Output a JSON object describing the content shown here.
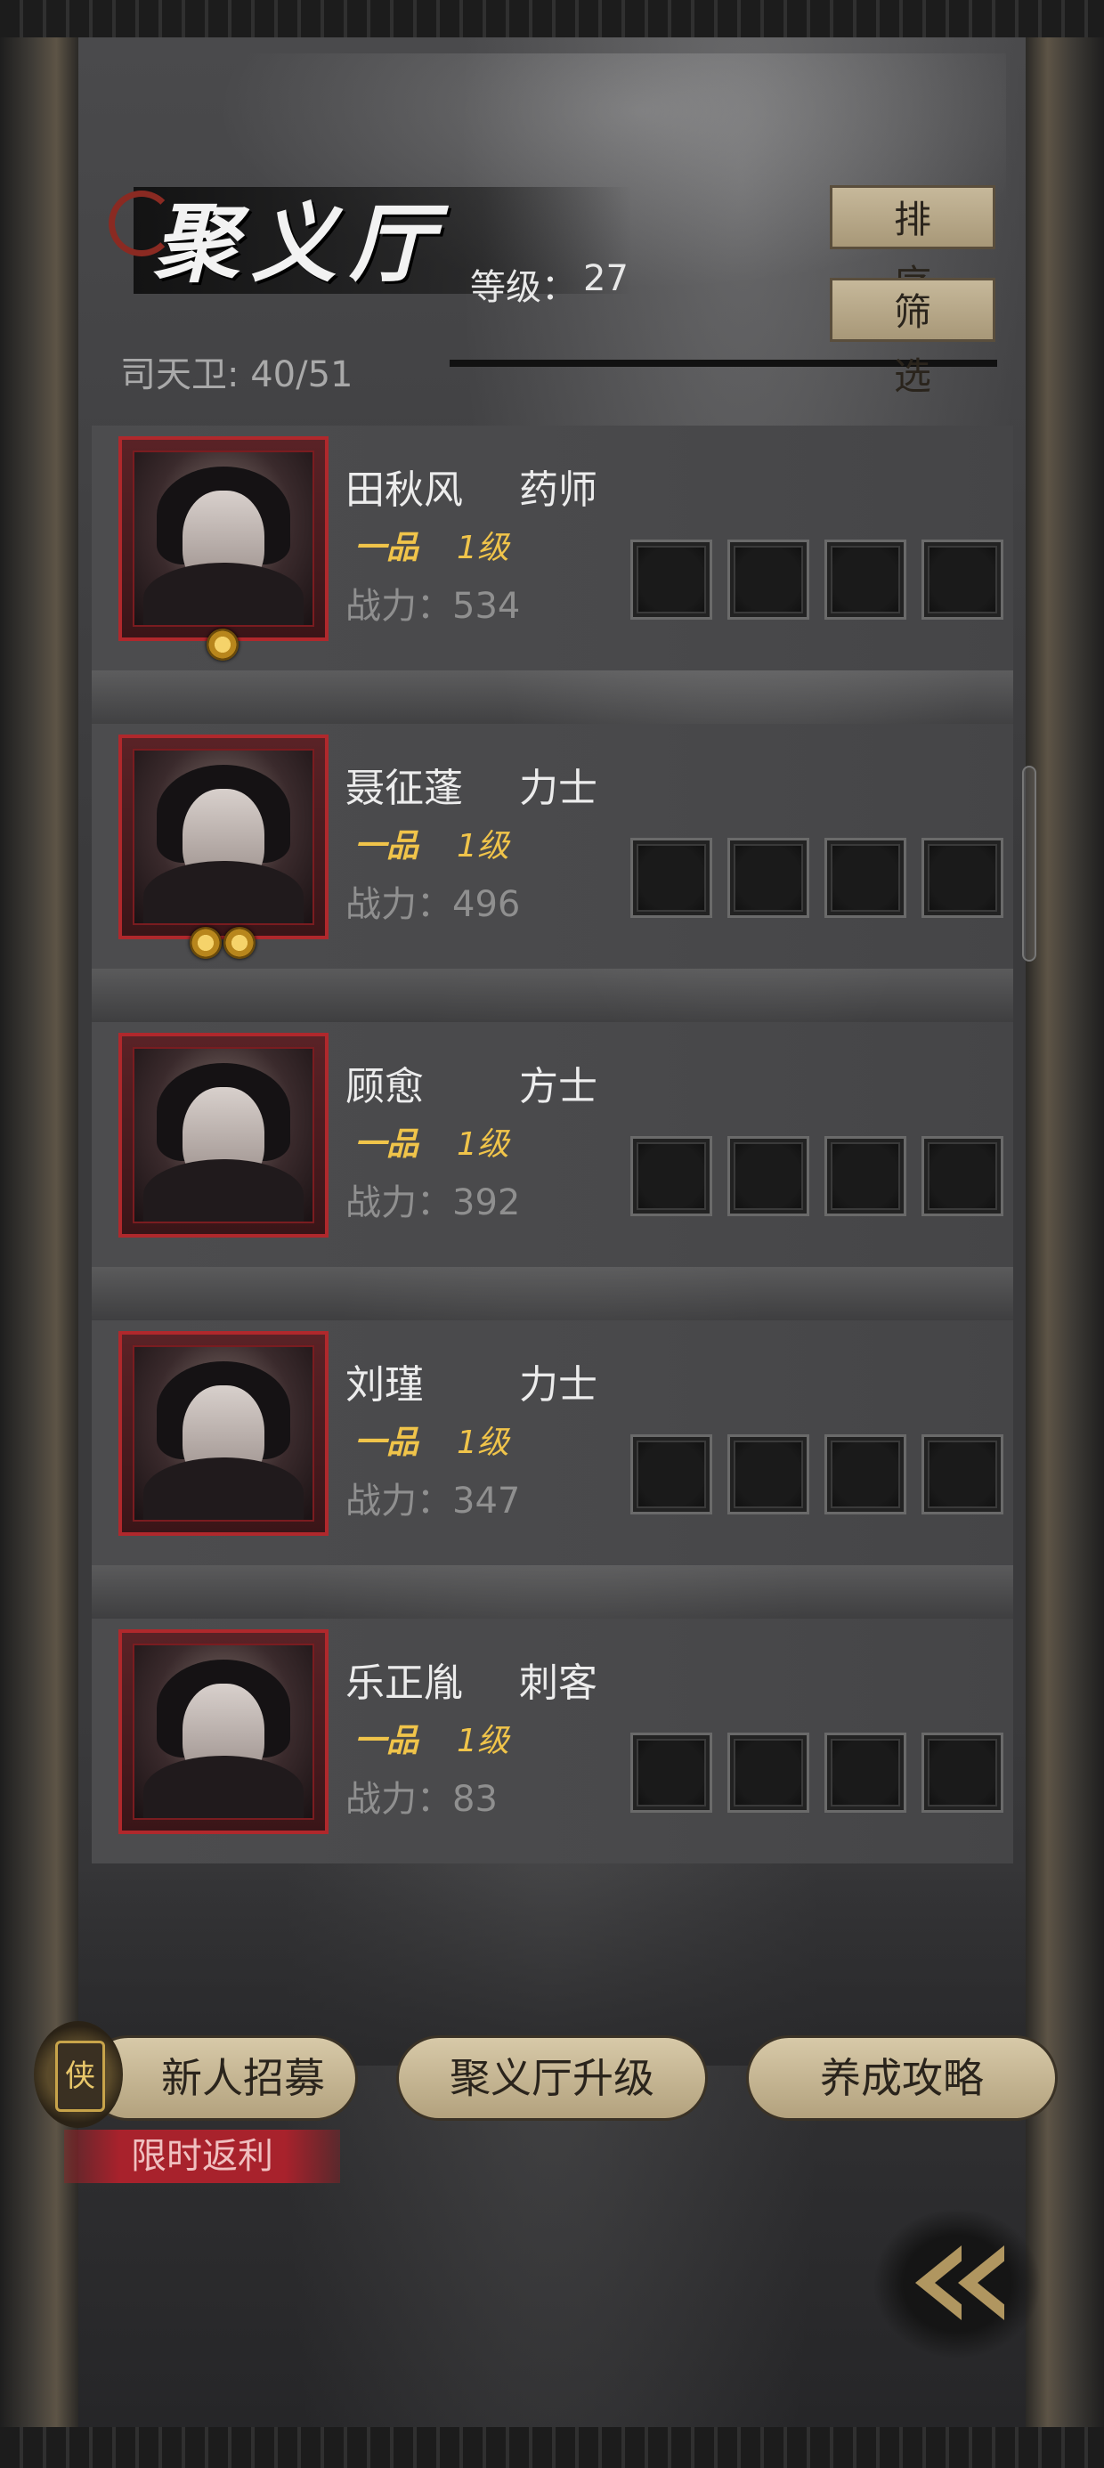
{
  "header": {
    "title": "聚义厅",
    "level_label": "等级：",
    "level_value": "27",
    "guard_count": "司天卫: 40/51",
    "sort_label": "排序",
    "filter_label": "筛选"
  },
  "heroes": [
    {
      "name": "田秋风",
      "class": "药师",
      "rank": "一品",
      "level": "1级",
      "power": "战力：534",
      "stars": 1
    },
    {
      "name": "聂征蓬",
      "class": "力士",
      "rank": "一品",
      "level": "1级",
      "power": "战力：496",
      "stars": 2
    },
    {
      "name": "顾愈",
      "class": "方士",
      "rank": "一品",
      "level": "1级",
      "power": "战力：392",
      "stars": 0
    },
    {
      "name": "刘瑾",
      "class": "力士",
      "rank": "一品",
      "level": "1级",
      "power": "战力：347",
      "stars": 0
    },
    {
      "name": "乐正胤",
      "class": "刺客",
      "rank": "一品",
      "level": "1级",
      "power": "战力：83",
      "stars": 0
    }
  ],
  "bottom": {
    "recruit_label": "新人招募",
    "recruit_badge_glyph": "侠",
    "upgrade_label": "聚义厅升级",
    "guide_label": "养成攻略",
    "promo_label": "限时返利"
  },
  "colors": {
    "accent_gold": "#f0c44a",
    "portrait_border": "#b0282c",
    "button_beige": "#c6b89a",
    "promo_red": "#a8222c"
  },
  "icons": [
    "chevron-double-left-icon",
    "star-badge-icon",
    "recruit-badge-icon"
  ]
}
